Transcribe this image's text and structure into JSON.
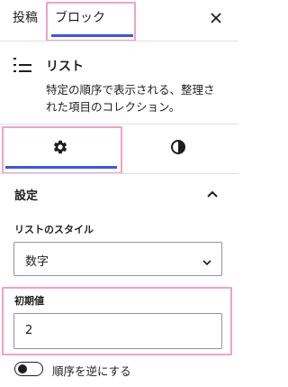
{
  "header": {
    "tabs": [
      {
        "label": "投稿"
      },
      {
        "label": "ブロック"
      }
    ],
    "close_icon": "close-icon"
  },
  "block_card": {
    "icon": "list-icon",
    "title": "リスト",
    "description_line1": "特定の順序で表示される、整理さ",
    "description_line2": "れた項目のコレクション。"
  },
  "inspector_tabs": [
    {
      "icon": "gear-icon",
      "name": "settings"
    },
    {
      "icon": "contrast-icon",
      "name": "styles"
    }
  ],
  "panel": {
    "title": "設定",
    "toggle_icon": "chevron-up-icon",
    "list_style": {
      "label": "リストのスタイル",
      "value": "数字",
      "icon": "chevron-down-icon"
    },
    "start_value": {
      "label": "初期値",
      "value": "2"
    },
    "reverse": {
      "label": "順序を逆にする",
      "checked": false
    }
  },
  "colors": {
    "accent": "#3858e9",
    "highlight": "#f0a1c8"
  }
}
